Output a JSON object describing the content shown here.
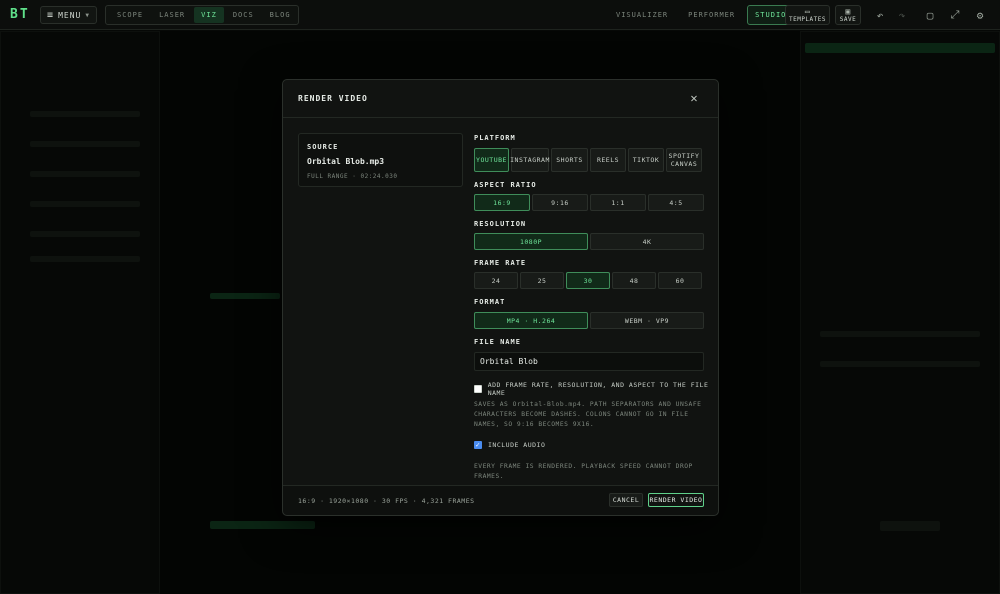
{
  "app": {
    "logo": "BT",
    "menu_label": "MENU",
    "nav": [
      "SCOPE",
      "LASER",
      "VIZ",
      "DOCS",
      "BLOG"
    ],
    "nav_active": "VIZ",
    "modes": [
      "VISUALIZER",
      "PERFORMER",
      "STUDIO"
    ],
    "mode_active": "STUDIO",
    "templates_label": "TEMPLATES",
    "save_label": "SAVE",
    "accent": "#6fe59a"
  },
  "modal": {
    "title": "RENDER VIDEO",
    "source": {
      "label": "SOURCE",
      "file": "Orbital Blob.mp3",
      "meta": "FULL RANGE · 02:24.030"
    },
    "platform": {
      "label": "PLATFORM",
      "options": [
        "YOUTUBE",
        "INSTAGRAM",
        "SHORTS",
        "REELS",
        "TIKTOK",
        "SPOTIFY CANVAS"
      ],
      "selected": "YOUTUBE"
    },
    "aspect_ratio": {
      "label": "ASPECT RATIO",
      "options": [
        "16:9",
        "9:16",
        "1:1",
        "4:5"
      ],
      "selected": "16:9"
    },
    "resolution": {
      "label": "RESOLUTION",
      "options": [
        "1080P",
        "4K"
      ],
      "selected": "1080P"
    },
    "frame_rate": {
      "label": "FRAME RATE",
      "options": [
        "24",
        "25",
        "30",
        "48",
        "60"
      ],
      "selected": "30"
    },
    "format": {
      "label": "FORMAT",
      "options": [
        "MP4 · H.264",
        "WEBM · VP9"
      ],
      "selected": "MP4 · H.264"
    },
    "file_name": {
      "label": "FILE NAME",
      "value": "Orbital Blob"
    },
    "append_option": {
      "label": "ADD FRAME RATE, RESOLUTION, AND ASPECT TO THE FILE NAME",
      "checked": false
    },
    "save_note": "SAVES AS Orbital-Blob.mp4. PATH SEPARATORS AND UNSAFE CHARACTERS BECOME DASHES. COLONS CANNOT GO IN FILE NAMES, SO 9:16 BECOMES 9X16.",
    "include_audio": {
      "label": "INCLUDE AUDIO",
      "checked": true
    },
    "render_note": "EVERY FRAME IS RENDERED. PLAYBACK SPEED CANNOT DROP FRAMES.",
    "footer_summary": "16:9 · 1920×1080 · 30 FPS · 4,321 FRAMES",
    "cancel_label": "CANCEL",
    "render_label": "RENDER VIDEO"
  }
}
